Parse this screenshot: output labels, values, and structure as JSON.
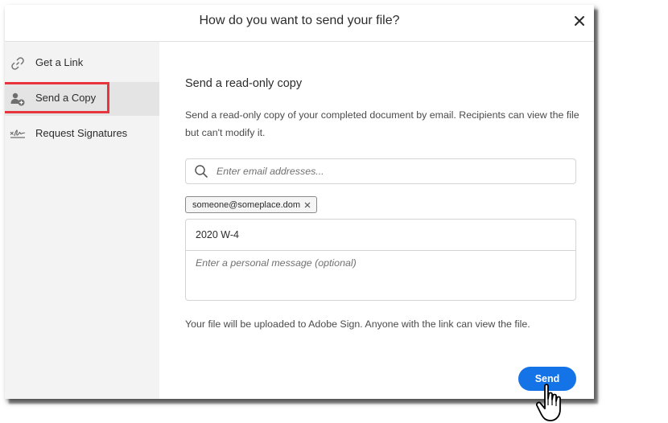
{
  "dialog": {
    "title": "How do you want to send your file?"
  },
  "sidebar": {
    "items": [
      {
        "label": "Get a Link",
        "icon": "link-icon",
        "active": false
      },
      {
        "label": "Send a Copy",
        "icon": "add-user-icon",
        "active": true
      },
      {
        "label": "Request Signatures",
        "icon": "signature-icon",
        "active": false
      }
    ]
  },
  "main": {
    "section_title": "Send a read-only copy",
    "description": "Send a read-only copy of your completed document by email. Recipients can view the file but can't modify it.",
    "email_input": {
      "placeholder": "Enter email addresses...",
      "value": ""
    },
    "recipients": [
      "someone@someplace.dom"
    ],
    "subject": "2020 W-4",
    "message_placeholder": "Enter a personal message (optional)",
    "note": "Your file will be uploaded to Adobe Sign. Anyone with the link can view the file.",
    "send_label": "Send"
  },
  "colors": {
    "accent": "#1473e6",
    "highlight": "#e8343d",
    "sidebar_bg": "#f3f3f3"
  }
}
